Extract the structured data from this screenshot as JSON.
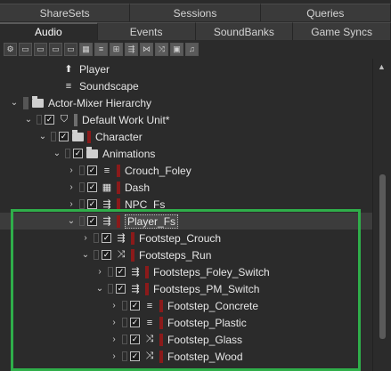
{
  "tabs_top": [
    "ShareSets",
    "Sessions",
    "Queries"
  ],
  "tabs_bottom": [
    "Audio",
    "Events",
    "SoundBanks",
    "Game Syncs"
  ],
  "active_tab": "Audio",
  "toolbar_icons": [
    "settings-icon",
    "folder-icon",
    "folder-icon",
    "folder-icon",
    "folder-icon",
    "grid-icon",
    "list-icon",
    "sequence-icon",
    "switch-icon",
    "blend-icon",
    "random-icon",
    "image-icon",
    "music-icon"
  ],
  "tree": [
    {
      "label": "Player",
      "icon": "upload-icon"
    },
    {
      "label": "Soundscape",
      "icon": "list-icon"
    },
    {
      "label": "Actor-Mixer Hierarchy",
      "icon": "folder-icon"
    },
    {
      "label": "Default Work Unit*",
      "icon": "work-unit-icon"
    },
    {
      "label": "Character",
      "icon": "folder-icon"
    },
    {
      "label": "Animations",
      "icon": "folder-icon"
    },
    {
      "label": "Crouch_Foley",
      "icon": "sequence-icon"
    },
    {
      "label": "Dash",
      "icon": "grid-icon"
    },
    {
      "label": "NPC_Fs",
      "icon": "switch-icon"
    },
    {
      "label": "Player_Fs",
      "icon": "switch-icon"
    },
    {
      "label": "Footstep_Crouch",
      "icon": "switch-icon"
    },
    {
      "label": "Footsteps_Run",
      "icon": "random-icon"
    },
    {
      "label": "Footsteps_Foley_Switch",
      "icon": "switch-icon"
    },
    {
      "label": "Footsteps_PM_Switch",
      "icon": "switch-icon"
    },
    {
      "label": "Footstep_Concrete",
      "icon": "sequence-icon"
    },
    {
      "label": "Footstep_Plastic",
      "icon": "sequence-icon"
    },
    {
      "label": "Footstep_Glass",
      "icon": "random-icon"
    },
    {
      "label": "Footstep_Wood",
      "icon": "random-icon"
    }
  ],
  "colors": {
    "accent_red": "#8b1a1a",
    "highlight_green": "#2fae4a",
    "background": "#2b2b2b"
  }
}
